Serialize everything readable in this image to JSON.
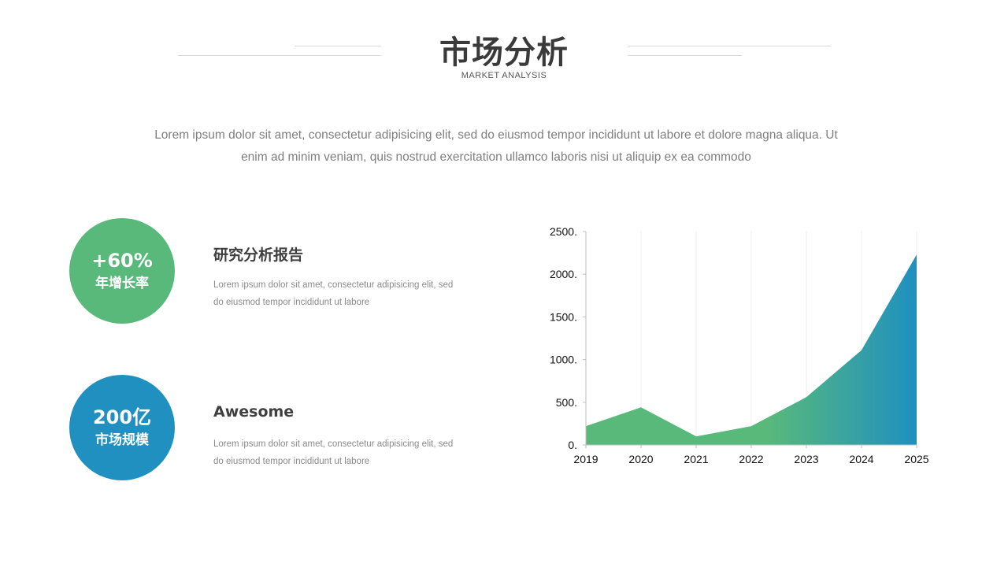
{
  "header": {
    "title": "市场分析",
    "subtitle": "MARKET ANALYSIS"
  },
  "intro": {
    "line1": "Lorem ipsum dolor sit amet, consectetur adipisicing elit, sed do eiusmod tempor incididunt ut labore et dolore magna aliqua. Ut",
    "line2": "enim ad minim veniam, quis nostrud exercitation ullamco laboris nisi ut aliquip ex ea commodo"
  },
  "stats": [
    {
      "value": "+60%",
      "label": "年增长率",
      "color": "#58b97b",
      "title": "研究分析报告",
      "desc_line1": "Lorem ipsum dolor sit amet, consectetur adipisicing elit, sed",
      "desc_line2": "do eiusmod tempor incididunt ut labore"
    },
    {
      "value": "200亿",
      "label": "市场规模",
      "color": "#1f90c0",
      "title": "Awesome",
      "desc_line1": "Lorem ipsum dolor sit amet, consectetur adipisicing elit, sed",
      "desc_line2": "do eiusmod tempor incididunt ut labore"
    }
  ],
  "chart_data": {
    "type": "area",
    "title": "",
    "xlabel": "",
    "ylabel": "",
    "x": [
      "2019",
      "2020",
      "2021",
      "2022",
      "2023",
      "2024",
      "2025"
    ],
    "y": [
      220,
      440,
      100,
      220,
      560,
      1110,
      2230
    ],
    "ylim": [
      0,
      2500
    ],
    "yticks": [
      0,
      500,
      1000,
      1500,
      2000,
      2500
    ],
    "ytick_labels": [
      "0.",
      "500.",
      "1000.",
      "1500.",
      "2000.",
      "2500."
    ],
    "grid": "vertical",
    "gradient": [
      "#58b97b",
      "#1f90c0"
    ]
  }
}
